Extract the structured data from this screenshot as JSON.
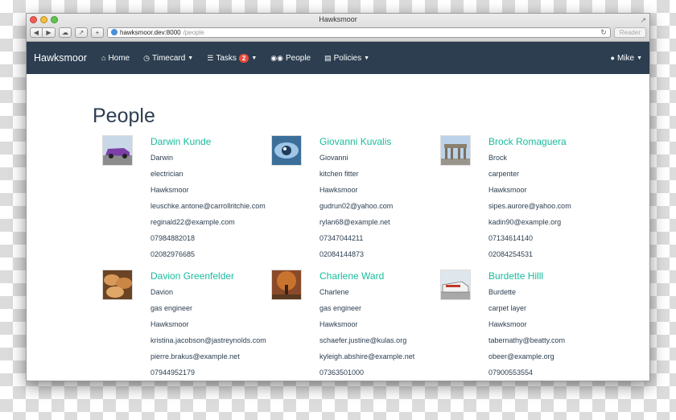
{
  "window": {
    "title": "Hawksmoor",
    "url_host": "hawksmoor.dev:8000",
    "url_path": "/people",
    "reader_label": "Reader"
  },
  "navbar": {
    "brand": "Hawksmoor",
    "items": [
      {
        "label": "Home",
        "icon": "home-icon"
      },
      {
        "label": "Timecard",
        "icon": "clock-icon"
      },
      {
        "label": "Tasks",
        "icon": "list-icon",
        "badge": "2"
      },
      {
        "label": "People",
        "icon": "users-icon"
      },
      {
        "label": "Policies",
        "icon": "file-icon"
      }
    ],
    "user": "Mike"
  },
  "page": {
    "title": "People"
  },
  "people": [
    {
      "name": "Darwin Kunde",
      "first": "Darwin",
      "job": "electrician",
      "company": "Hawksmoor",
      "email1": "leuschke.antone@carrollritchie.com",
      "email2": "reginald22@example.com",
      "phone1": "07984882018",
      "phone2": "02082976685",
      "thumb": "car"
    },
    {
      "name": "Giovanni Kuvalis",
      "first": "Giovanni",
      "job": "kitchen fitter",
      "company": "Hawksmoor",
      "email1": "gudrun02@yahoo.com",
      "email2": "rylan68@example.net",
      "phone1": "07347044211",
      "phone2": "02084144873",
      "thumb": "eye"
    },
    {
      "name": "Brock Romaguera",
      "first": "Brock",
      "job": "carpenter",
      "company": "Hawksmoor",
      "email1": "sipes.aurore@yahoo.com",
      "email2": "kadin90@example.org",
      "phone1": "07134614140",
      "phone2": "02084254531",
      "thumb": "gate"
    },
    {
      "name": "Davion Greenfelder",
      "first": "Davion",
      "job": "gas engineer",
      "company": "Hawksmoor",
      "email1": "kristina.jacobson@jastreynolds.com",
      "email2": "pierre.brakus@example.net",
      "phone1": "07944952179",
      "phone2": "",
      "thumb": "bread"
    },
    {
      "name": "Charlene Ward",
      "first": "Charlene",
      "job": "gas engineer",
      "company": "Hawksmoor",
      "email1": "schaefer.justine@kulas.org",
      "email2": "kyleigh.abshire@example.net",
      "phone1": "07363501000",
      "phone2": "",
      "thumb": "tree"
    },
    {
      "name": "Burdette Hilll",
      "first": "Burdette",
      "job": "carpet layer",
      "company": "Hawksmoor",
      "email1": "tabernathy@beatty.com",
      "email2": "obeer@example.org",
      "phone1": "07900553554",
      "phone2": "",
      "thumb": "train"
    }
  ]
}
